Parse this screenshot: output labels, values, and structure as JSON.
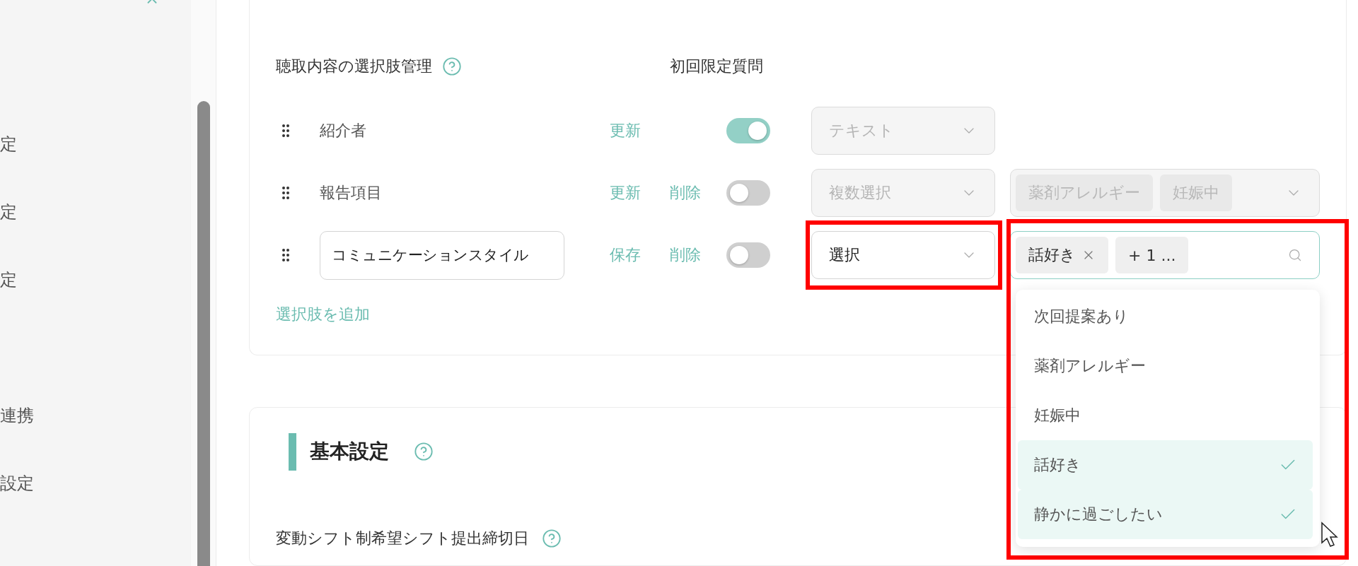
{
  "sidebar": {
    "items": [
      "定",
      "定",
      "定",
      "連携",
      "設定"
    ]
  },
  "choices_card": {
    "title": "聴取内容の選択肢管理",
    "first_time_header": "初回限定質問",
    "rows": [
      {
        "kind": "text",
        "label": "紹介者",
        "actions": [
          "更新"
        ],
        "first_time_only": true,
        "type_select": {
          "value": "テキスト",
          "disabled": true
        }
      },
      {
        "kind": "text",
        "label": "報告項目",
        "actions": [
          "更新",
          "削除"
        ],
        "first_time_only": false,
        "type_select": {
          "value": "複数選択",
          "disabled": true
        },
        "options_select": {
          "disabled": true,
          "open": false,
          "tags": [
            {
              "label": "薬剤アレルギー",
              "removable": false
            },
            {
              "label": "妊娠中",
              "removable": false
            }
          ]
        }
      },
      {
        "kind": "input",
        "label": "コミュニケーションスタイル",
        "actions": [
          "保存",
          "削除"
        ],
        "first_time_only": false,
        "type_select": {
          "value": "選択",
          "disabled": false,
          "highlighted": true
        },
        "options_select": {
          "disabled": false,
          "open": true,
          "highlighted": true,
          "tags": [
            {
              "label": "話好き",
              "removable": true
            },
            {
              "label": "+ 1 ...",
              "removable": false
            }
          ],
          "options": [
            {
              "label": "次回提案あり",
              "selected": false
            },
            {
              "label": "薬剤アレルギー",
              "selected": false
            },
            {
              "label": "妊娠中",
              "selected": false
            },
            {
              "label": "話好き",
              "selected": true
            },
            {
              "label": "静かに過ごしたい",
              "selected": true
            }
          ]
        }
      }
    ],
    "add_link": "選択肢を追加"
  },
  "basic_settings": {
    "title": "基本設定",
    "field_label": "変動シフト制希望シフト提出締切日"
  }
}
